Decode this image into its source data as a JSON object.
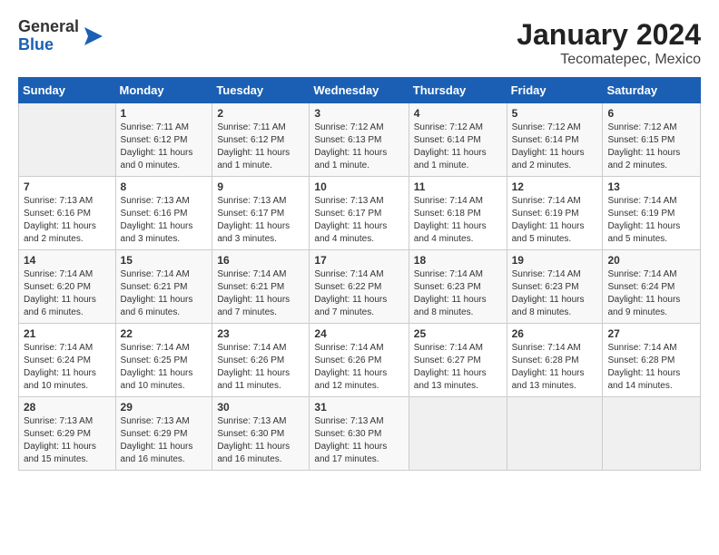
{
  "header": {
    "logo": {
      "general": "General",
      "blue": "Blue"
    },
    "title": "January 2024",
    "subtitle": "Tecomatepec, Mexico"
  },
  "calendar": {
    "days_of_week": [
      "Sunday",
      "Monday",
      "Tuesday",
      "Wednesday",
      "Thursday",
      "Friday",
      "Saturday"
    ],
    "weeks": [
      [
        {
          "day": "",
          "info": ""
        },
        {
          "day": "1",
          "info": "Sunrise: 7:11 AM\nSunset: 6:12 PM\nDaylight: 11 hours\nand 0 minutes."
        },
        {
          "day": "2",
          "info": "Sunrise: 7:11 AM\nSunset: 6:12 PM\nDaylight: 11 hours\nand 1 minute."
        },
        {
          "day": "3",
          "info": "Sunrise: 7:12 AM\nSunset: 6:13 PM\nDaylight: 11 hours\nand 1 minute."
        },
        {
          "day": "4",
          "info": "Sunrise: 7:12 AM\nSunset: 6:14 PM\nDaylight: 11 hours\nand 1 minute."
        },
        {
          "day": "5",
          "info": "Sunrise: 7:12 AM\nSunset: 6:14 PM\nDaylight: 11 hours\nand 2 minutes."
        },
        {
          "day": "6",
          "info": "Sunrise: 7:12 AM\nSunset: 6:15 PM\nDaylight: 11 hours\nand 2 minutes."
        }
      ],
      [
        {
          "day": "7",
          "info": "Sunrise: 7:13 AM\nSunset: 6:16 PM\nDaylight: 11 hours\nand 2 minutes."
        },
        {
          "day": "8",
          "info": "Sunrise: 7:13 AM\nSunset: 6:16 PM\nDaylight: 11 hours\nand 3 minutes."
        },
        {
          "day": "9",
          "info": "Sunrise: 7:13 AM\nSunset: 6:17 PM\nDaylight: 11 hours\nand 3 minutes."
        },
        {
          "day": "10",
          "info": "Sunrise: 7:13 AM\nSunset: 6:17 PM\nDaylight: 11 hours\nand 4 minutes."
        },
        {
          "day": "11",
          "info": "Sunrise: 7:14 AM\nSunset: 6:18 PM\nDaylight: 11 hours\nand 4 minutes."
        },
        {
          "day": "12",
          "info": "Sunrise: 7:14 AM\nSunset: 6:19 PM\nDaylight: 11 hours\nand 5 minutes."
        },
        {
          "day": "13",
          "info": "Sunrise: 7:14 AM\nSunset: 6:19 PM\nDaylight: 11 hours\nand 5 minutes."
        }
      ],
      [
        {
          "day": "14",
          "info": "Sunrise: 7:14 AM\nSunset: 6:20 PM\nDaylight: 11 hours\nand 6 minutes."
        },
        {
          "day": "15",
          "info": "Sunrise: 7:14 AM\nSunset: 6:21 PM\nDaylight: 11 hours\nand 6 minutes."
        },
        {
          "day": "16",
          "info": "Sunrise: 7:14 AM\nSunset: 6:21 PM\nDaylight: 11 hours\nand 7 minutes."
        },
        {
          "day": "17",
          "info": "Sunrise: 7:14 AM\nSunset: 6:22 PM\nDaylight: 11 hours\nand 7 minutes."
        },
        {
          "day": "18",
          "info": "Sunrise: 7:14 AM\nSunset: 6:23 PM\nDaylight: 11 hours\nand 8 minutes."
        },
        {
          "day": "19",
          "info": "Sunrise: 7:14 AM\nSunset: 6:23 PM\nDaylight: 11 hours\nand 8 minutes."
        },
        {
          "day": "20",
          "info": "Sunrise: 7:14 AM\nSunset: 6:24 PM\nDaylight: 11 hours\nand 9 minutes."
        }
      ],
      [
        {
          "day": "21",
          "info": "Sunrise: 7:14 AM\nSunset: 6:24 PM\nDaylight: 11 hours\nand 10 minutes."
        },
        {
          "day": "22",
          "info": "Sunrise: 7:14 AM\nSunset: 6:25 PM\nDaylight: 11 hours\nand 10 minutes."
        },
        {
          "day": "23",
          "info": "Sunrise: 7:14 AM\nSunset: 6:26 PM\nDaylight: 11 hours\nand 11 minutes."
        },
        {
          "day": "24",
          "info": "Sunrise: 7:14 AM\nSunset: 6:26 PM\nDaylight: 11 hours\nand 12 minutes."
        },
        {
          "day": "25",
          "info": "Sunrise: 7:14 AM\nSunset: 6:27 PM\nDaylight: 11 hours\nand 13 minutes."
        },
        {
          "day": "26",
          "info": "Sunrise: 7:14 AM\nSunset: 6:28 PM\nDaylight: 11 hours\nand 13 minutes."
        },
        {
          "day": "27",
          "info": "Sunrise: 7:14 AM\nSunset: 6:28 PM\nDaylight: 11 hours\nand 14 minutes."
        }
      ],
      [
        {
          "day": "28",
          "info": "Sunrise: 7:13 AM\nSunset: 6:29 PM\nDaylight: 11 hours\nand 15 minutes."
        },
        {
          "day": "29",
          "info": "Sunrise: 7:13 AM\nSunset: 6:29 PM\nDaylight: 11 hours\nand 16 minutes."
        },
        {
          "day": "30",
          "info": "Sunrise: 7:13 AM\nSunset: 6:30 PM\nDaylight: 11 hours\nand 16 minutes."
        },
        {
          "day": "31",
          "info": "Sunrise: 7:13 AM\nSunset: 6:30 PM\nDaylight: 11 hours\nand 17 minutes."
        },
        {
          "day": "",
          "info": ""
        },
        {
          "day": "",
          "info": ""
        },
        {
          "day": "",
          "info": ""
        }
      ]
    ]
  }
}
